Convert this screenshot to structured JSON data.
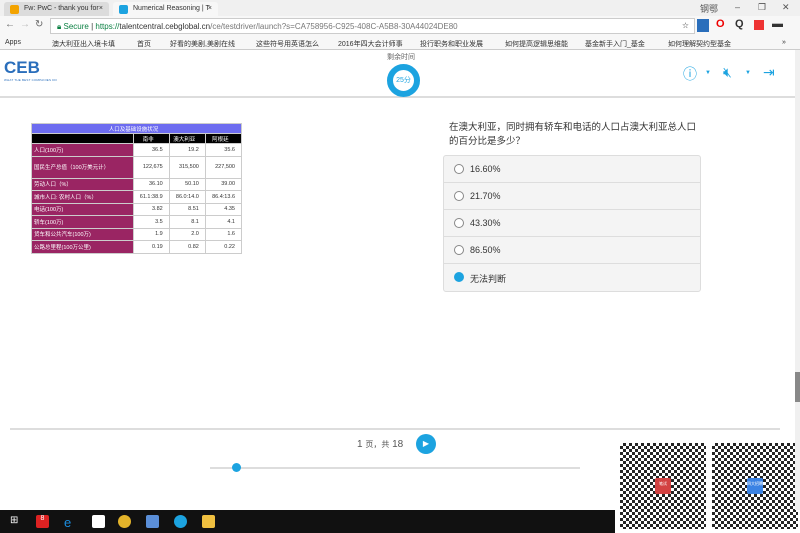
{
  "browser": {
    "tabs": [
      {
        "title": "Fw: PwC - thank you for"
      },
      {
        "title": "Numerical Reasoning | T"
      }
    ],
    "user": "钢鄂",
    "secure_label": "Secure",
    "url_https": "https://",
    "url_host": "talentcentral.cebglobal.cn",
    "url_path": "/ce/testdriver/launch?s=CA758956-C925-408C-A5B8-30A44024DE80",
    "bookmarks": [
      "Apps",
      "澳大利亚出入境卡填",
      "首页",
      "好看的美剧,美剧在线",
      "这些符号用英语怎么",
      "2016年四大会计师事",
      "投行职务和职业发展",
      "如何提高逻辑思维能",
      "基金新手入门_基金",
      "如何理解契约型基金"
    ]
  },
  "header": {
    "logo": "CEB",
    "tagline": "WHAT THE BEST COMPANIES DO",
    "timer_label": "剩余时间",
    "timer_value": "25分"
  },
  "table": {
    "caption": "人口及基础设施状况",
    "columns": [
      "",
      "南非",
      "澳大利亚",
      "阿根廷"
    ],
    "rows": [
      [
        "人口(100万)",
        "36.5",
        "19.2",
        "35.6"
      ],
      [
        "国民生产总值（100万美元计）",
        "122,675",
        "315,500",
        "227,500"
      ],
      [
        "劳动人口（%）",
        "36.10",
        "50.10",
        "39.00"
      ],
      [
        "城市人口: 农村人口（%）",
        "61.1:38.9",
        "86.0:14.0",
        "86.4:13.6"
      ],
      [
        "电话(100万)",
        "3.82",
        "8.51",
        "4.35"
      ],
      [
        "轿车(100万)",
        "3.5",
        "8.1",
        "4.1"
      ],
      [
        "货车和公共汽车(100万)",
        "1.9",
        "2.0",
        "1.6"
      ],
      [
        "公路总里程(100万公里)",
        "0.19",
        "0.82",
        "0.22"
      ]
    ]
  },
  "question": "在澳大利亚，同时拥有轿车和电话的人口占澳大利亚总人口的百分比是多少？",
  "options": [
    "16.60%",
    "21.70%",
    "43.30%",
    "86.50%",
    "无法判断"
  ],
  "selected_index": 4,
  "pager": {
    "current": "1",
    "sep": "页，共",
    "total": "18"
  },
  "progress_fraction": 0.06,
  "qr_badges": [
    "笔试",
    "四大招聘"
  ],
  "taskbar_badge": "8"
}
